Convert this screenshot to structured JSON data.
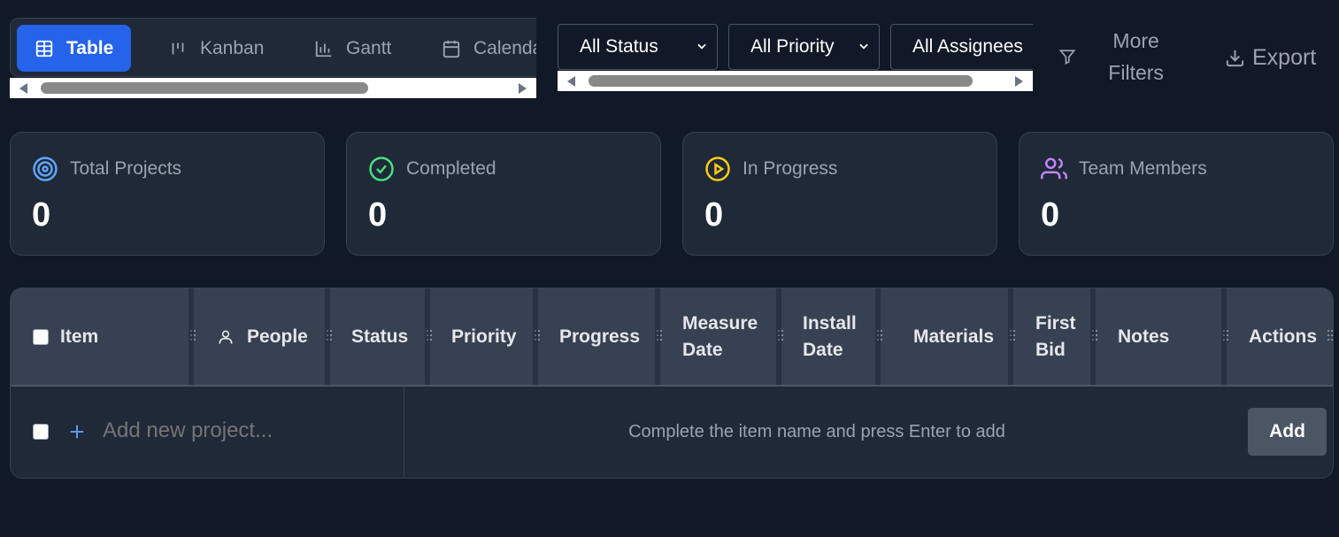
{
  "views": {
    "tabs": [
      {
        "label": "Table",
        "icon": "table-icon",
        "active": true
      },
      {
        "label": "Kanban",
        "icon": "kanban-icon",
        "active": false
      },
      {
        "label": "Gantt",
        "icon": "gantt-chart-icon",
        "active": false
      },
      {
        "label": "Calendar",
        "icon": "calendar-icon",
        "active": false
      }
    ]
  },
  "filters": {
    "status": "All Status",
    "priority": "All Priority",
    "assignees": "All Assignees",
    "more_filters": "More Filters",
    "export": "Export"
  },
  "stats": [
    {
      "label": "Total Projects",
      "value": "0",
      "icon": "target-icon",
      "color": "#60a5fa"
    },
    {
      "label": "Completed",
      "value": "0",
      "icon": "check-circle-icon",
      "color": "#4ade80"
    },
    {
      "label": "In Progress",
      "value": "0",
      "icon": "play-circle-icon",
      "color": "#facc15"
    },
    {
      "label": "Team Members",
      "value": "0",
      "icon": "users-icon",
      "color": "#c084fc"
    }
  ],
  "table": {
    "columns": [
      "Item",
      "People",
      "Status",
      "Priority",
      "Progress",
      "Measure Date",
      "Install Date",
      "Materials",
      "First Bid",
      "Notes",
      "Actions"
    ],
    "add_placeholder": "Add new project...",
    "hint": "Complete the item name and press Enter to add",
    "add_label": "Add"
  },
  "colors": {
    "background": "#111827",
    "surface": "#1f2937",
    "header": "#374151",
    "accent": "#2563eb"
  }
}
